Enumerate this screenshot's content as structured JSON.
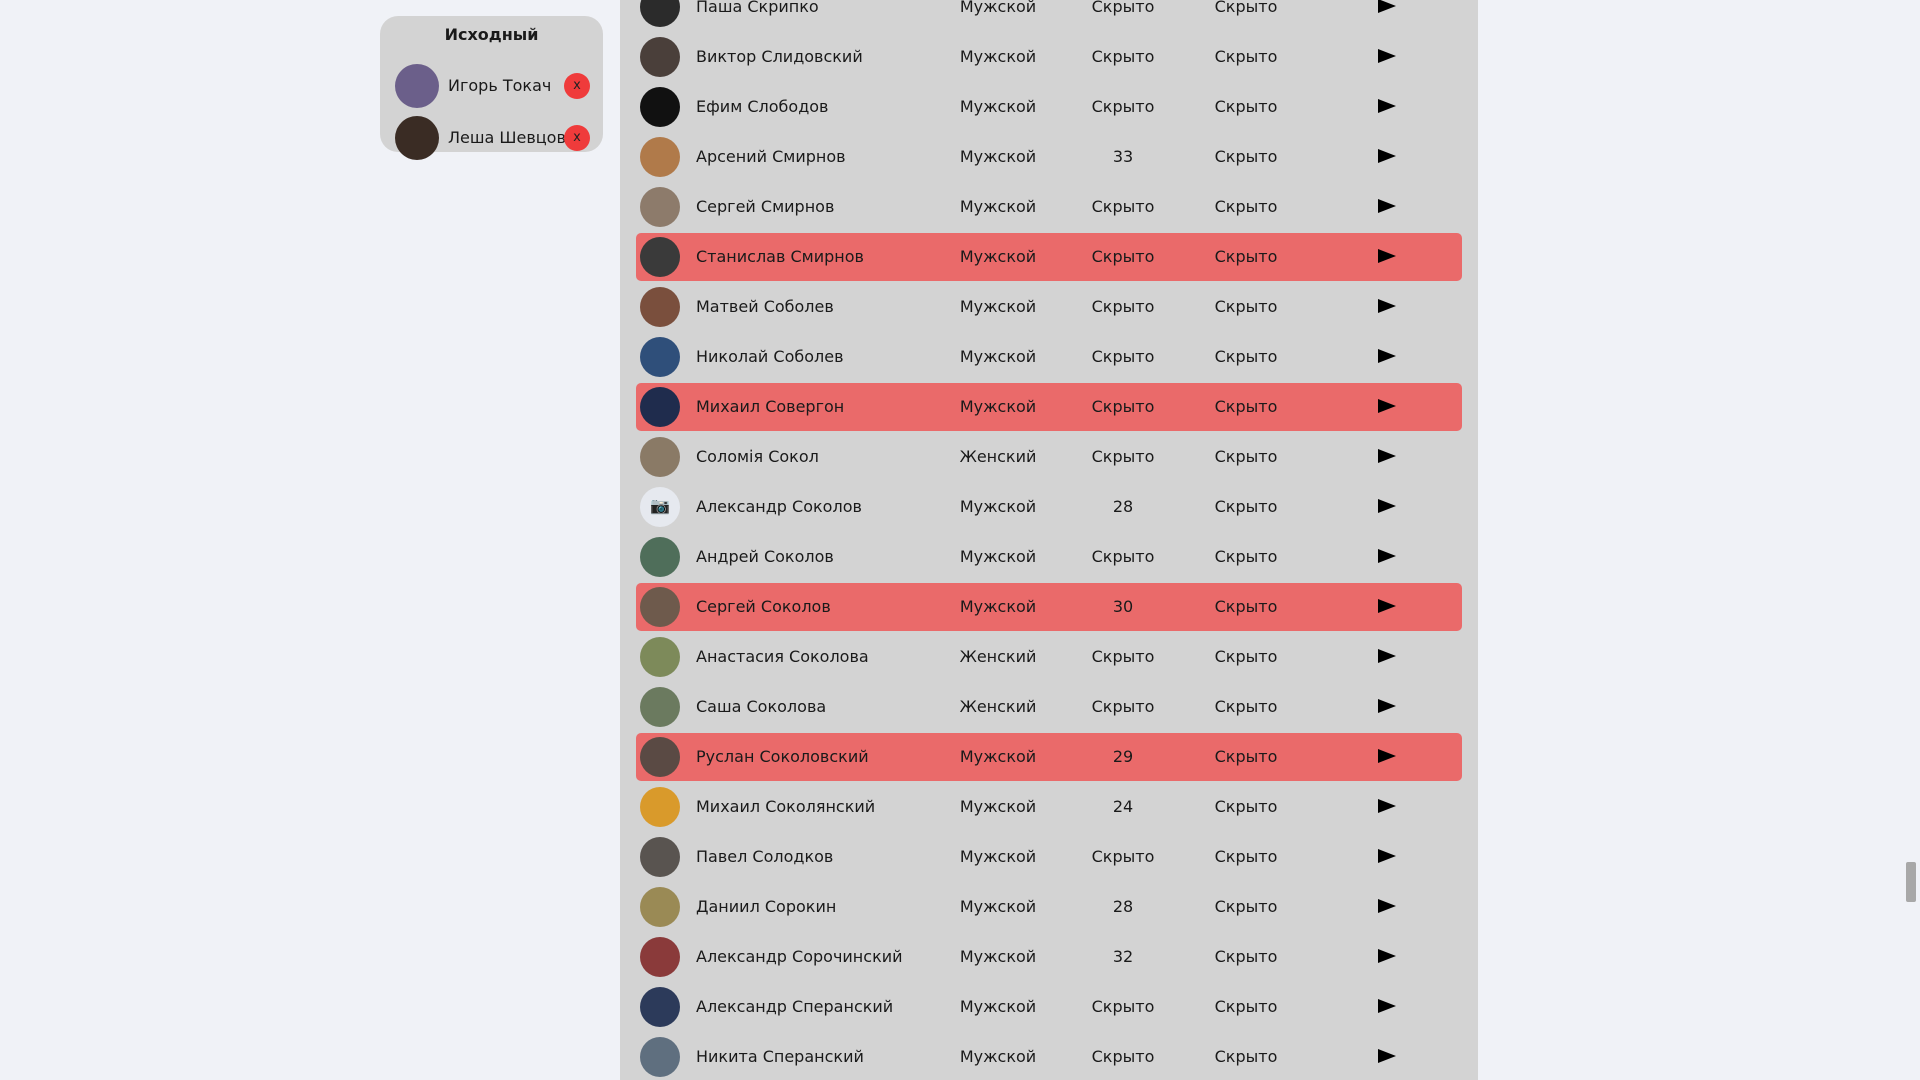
{
  "source": {
    "title": "Исходный",
    "remove_label": "x",
    "items": [
      {
        "name": "Игорь Токач",
        "avatar_color": "#6b5f8a"
      },
      {
        "name": "Леша Шевцов",
        "avatar_color": "#3a2c24"
      }
    ]
  },
  "users": [
    {
      "name": "Паша Скрипко",
      "gender": "Мужской",
      "age": "Скрыто",
      "city": "Скрыто",
      "highlight": false,
      "avatar_color": "#2b2b2b"
    },
    {
      "name": "Виктор Слидовский",
      "gender": "Мужской",
      "age": "Скрыто",
      "city": "Скрыто",
      "highlight": false,
      "avatar_color": "#4a3f3a"
    },
    {
      "name": "Ефим Слободов",
      "gender": "Мужской",
      "age": "Скрыто",
      "city": "Скрыто",
      "highlight": false,
      "avatar_color": "#111111"
    },
    {
      "name": "Арсений Смирнов",
      "gender": "Мужской",
      "age": "33",
      "city": "Скрыто",
      "highlight": false,
      "avatar_color": "#b07a4a"
    },
    {
      "name": "Сергей Смирнов",
      "gender": "Мужской",
      "age": "Скрыто",
      "city": "Скрыто",
      "highlight": false,
      "avatar_color": "#8d7b6b"
    },
    {
      "name": "Станислав Смирнов",
      "gender": "Мужской",
      "age": "Скрыто",
      "city": "Скрыто",
      "highlight": true,
      "avatar_color": "#3a3a3a"
    },
    {
      "name": "Матвей Соболев",
      "gender": "Мужской",
      "age": "Скрыто",
      "city": "Скрыто",
      "highlight": false,
      "avatar_color": "#7a4f3d"
    },
    {
      "name": "Николай Соболев",
      "gender": "Мужской",
      "age": "Скрыто",
      "city": "Скрыто",
      "highlight": false,
      "avatar_color": "#2f4f7a"
    },
    {
      "name": "Михаил Совергон",
      "gender": "Мужской",
      "age": "Скрыто",
      "city": "Скрыто",
      "highlight": true,
      "avatar_color": "#1f2c4d"
    },
    {
      "name": "Соломія Сокол",
      "gender": "Женский",
      "age": "Скрыто",
      "city": "Скрыто",
      "highlight": false,
      "avatar_color": "#8a7a66"
    },
    {
      "name": "Александр Соколов",
      "gender": "Мужской",
      "age": "28",
      "city": "Скрыто",
      "highlight": false,
      "avatar_color": "#e6e9ef",
      "placeholder": true
    },
    {
      "name": "Андрей Соколов",
      "gender": "Мужской",
      "age": "Скрыто",
      "city": "Скрыто",
      "highlight": false,
      "avatar_color": "#4f6e5a"
    },
    {
      "name": "Сергей Соколов",
      "gender": "Мужской",
      "age": "30",
      "city": "Скрыто",
      "highlight": true,
      "avatar_color": "#6e5a4c"
    },
    {
      "name": "Анастасия Соколова",
      "gender": "Женский",
      "age": "Скрыто",
      "city": "Скрыто",
      "highlight": false,
      "avatar_color": "#7d8a5a"
    },
    {
      "name": "Саша Соколова",
      "gender": "Женский",
      "age": "Скрыто",
      "city": "Скрыто",
      "highlight": false,
      "avatar_color": "#6b7a5f"
    },
    {
      "name": "Руслан Соколовский",
      "gender": "Мужской",
      "age": "29",
      "city": "Скрыто",
      "highlight": true,
      "avatar_color": "#5a4a44"
    },
    {
      "name": "Михаил Соколянский",
      "gender": "Мужской",
      "age": "24",
      "city": "Скрыто",
      "highlight": false,
      "avatar_color": "#d99a2b"
    },
    {
      "name": "Павел Солодков",
      "gender": "Мужской",
      "age": "Скрыто",
      "city": "Скрыто",
      "highlight": false,
      "avatar_color": "#595450"
    },
    {
      "name": "Даниил Сорокин",
      "gender": "Мужской",
      "age": "28",
      "city": "Скрыто",
      "highlight": false,
      "avatar_color": "#9a8a55"
    },
    {
      "name": "Александр Сорочинский",
      "gender": "Мужской",
      "age": "32",
      "city": "Скрыто",
      "highlight": false,
      "avatar_color": "#8a3a3a"
    },
    {
      "name": "Александр Сперанский",
      "gender": "Мужской",
      "age": "Скрыто",
      "city": "Скрыто",
      "highlight": false,
      "avatar_color": "#2c3a5a"
    },
    {
      "name": "Никита Сперанский",
      "gender": "Мужской",
      "age": "Скрыто",
      "city": "Скрыто",
      "highlight": false,
      "avatar_color": "#5f6f7f"
    }
  ],
  "colors": {
    "panel": "#d3d3d3",
    "highlight": "#ea6a6a",
    "remove": "#ef3b3b",
    "background": "#f0f2f7"
  },
  "icons": {
    "play": "play-icon",
    "camera": "camera-icon",
    "remove": "close-icon"
  }
}
